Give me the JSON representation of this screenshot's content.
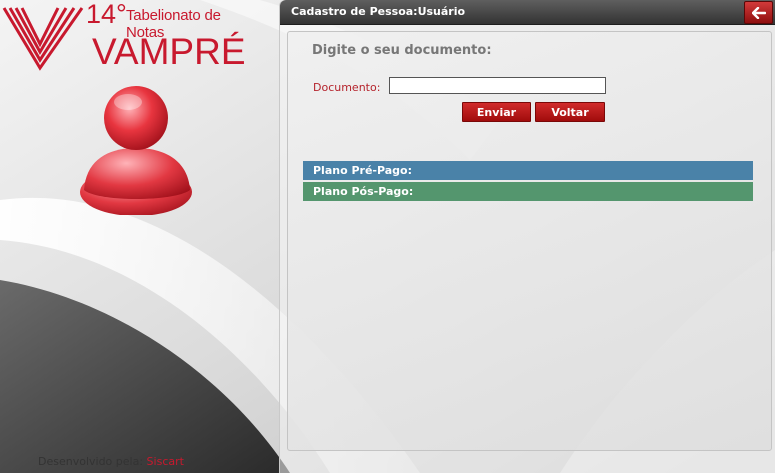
{
  "logo": {
    "number": "14°",
    "subtitle": "Tabelionato de Notas",
    "name": "VAMPRÉ"
  },
  "credit": {
    "prefix": "Desenvolvido pela:",
    "brand": "Siscart"
  },
  "panel": {
    "title": "Cadastro de Pessoa:Usuário",
    "heading": "Digite o seu documento:",
    "document_label": "Documento:",
    "document_value": "",
    "send_label": "Enviar",
    "back_label": "Voltar",
    "plans": [
      {
        "label": "Plano Pré-Pago:",
        "color": "#4a82a8"
      },
      {
        "label": "Plano Pós-Pago:",
        "color": "#54966e"
      }
    ]
  },
  "colors": {
    "brand_red": "#c8192e",
    "title_bar": "#3f3f3f"
  },
  "icons": {
    "back": "arrow-left-icon",
    "user": "user-avatar-icon",
    "logo": "v-logo-icon"
  }
}
